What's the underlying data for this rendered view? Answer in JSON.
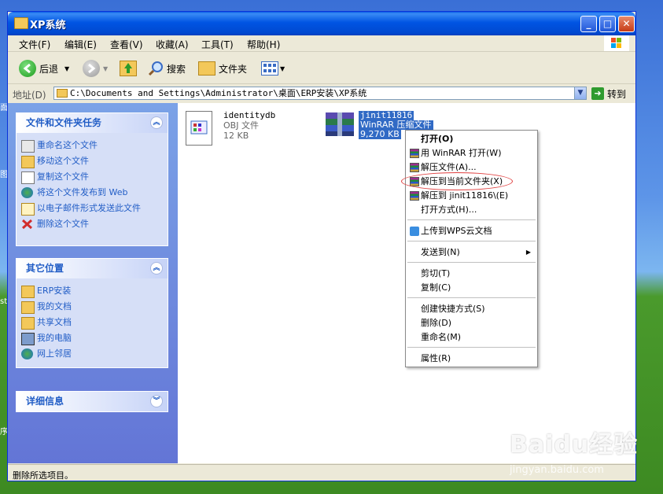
{
  "window": {
    "title": "XP系统"
  },
  "menu": [
    "文件(F)",
    "编辑(E)",
    "查看(V)",
    "收藏(A)",
    "工具(T)",
    "帮助(H)"
  ],
  "toolbar": {
    "back": "后退",
    "search": "搜索",
    "folders": "文件夹"
  },
  "address": {
    "label": "地址(D)",
    "path": "C:\\Documents and Settings\\Administrator\\桌面\\ERP安装\\XP系统",
    "go": "转到"
  },
  "tasks": {
    "title": "文件和文件夹任务",
    "items": [
      "重命名这个文件",
      "移动这个文件",
      "复制这个文件",
      "将这个文件发布到 Web",
      "以电子邮件形式发送此文件",
      "删除这个文件"
    ]
  },
  "places": {
    "title": "其它位置",
    "items": [
      "ERP安装",
      "我的文档",
      "共享文档",
      "我的电脑",
      "网上邻居"
    ]
  },
  "details": {
    "title": "详细信息"
  },
  "files": [
    {
      "name": "identitydb",
      "type": "OBJ 文件",
      "size": "12 KB"
    },
    {
      "name": "jinit11816",
      "type": "WinRAR 压缩文件",
      "size": "9,270 KB"
    }
  ],
  "context_menu": {
    "open": "打开(O)",
    "winrar_open": "用 WinRAR 打开(W)",
    "extract": "解压文件(A)...",
    "extract_here": "解压到当前文件夹(X)",
    "extract_to": "解压到 jinit11816\\(E)",
    "open_with": "打开方式(H)...",
    "wps_upload": "上传到WPS云文档",
    "send_to": "发送到(N)",
    "cut": "剪切(T)",
    "copy": "复制(C)",
    "shortcut": "创建快捷方式(S)",
    "delete": "删除(D)",
    "rename": "重命名(M)",
    "properties": "属性(R)"
  },
  "status": {
    "text": "删除所选项目。"
  },
  "watermark": {
    "logo": "Baidu经验",
    "url": "jingyan.baidu.com"
  },
  "colors": {
    "title_blue": "#0054e3",
    "task_link": "#215dc6",
    "selection": "#316ac5",
    "ring_red": "#e04040"
  }
}
